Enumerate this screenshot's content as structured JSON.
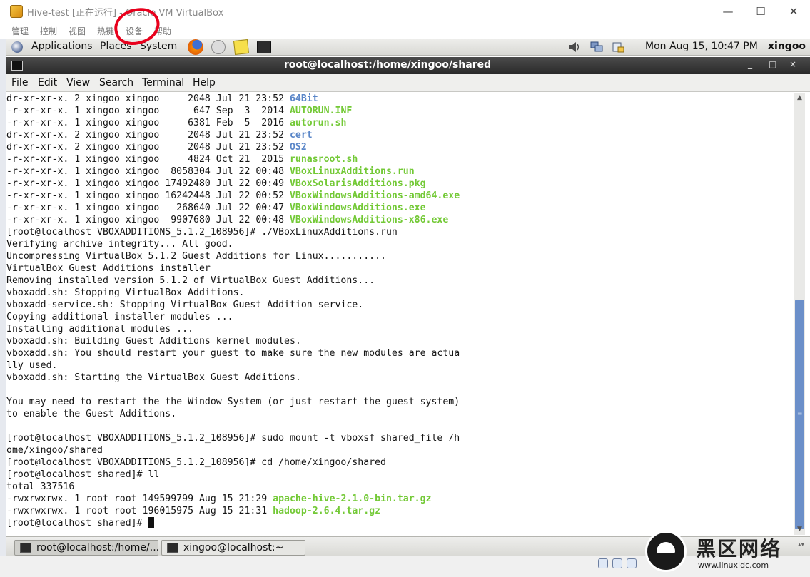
{
  "window": {
    "title": "Hive-test [正在运行] - Oracle VM VirtualBox",
    "minimize_glyph": "—",
    "maximize_glyph": "☐",
    "close_glyph": "✕"
  },
  "vb_menu": [
    "管理",
    "控制",
    "视图",
    "热键",
    "设备",
    "帮助"
  ],
  "gnome_panel": {
    "menus": [
      "Applications",
      "Places",
      "System"
    ],
    "launchers": [
      "firefox-icon",
      "mail-icon",
      "notes-icon",
      "terminal-icon"
    ],
    "tray": [
      "volume-icon",
      "network-icon",
      "updates-icon"
    ],
    "clock": "Mon Aug 15, 10:47 PM",
    "user": "xingoo"
  },
  "terminal": {
    "title": "root@localhost:/home/xingoo/shared",
    "controls": [
      "_",
      "□",
      "×"
    ],
    "menu": [
      "File",
      "Edit",
      "View",
      "Search",
      "Terminal",
      "Help"
    ],
    "lines": [
      [
        {
          "t": "dr-xr-xr-x. 2 xingoo xingoo     2048 Jul 21 23:52 "
        },
        {
          "t": "64Bit",
          "c": "dir"
        }
      ],
      [
        {
          "t": "-r-xr-xr-x. 1 xingoo xingoo      647 Sep  3  2014 "
        },
        {
          "t": "AUTORUN.INF",
          "c": "exe"
        }
      ],
      [
        {
          "t": "-r-xr-xr-x. 1 xingoo xingoo     6381 Feb  5  2016 "
        },
        {
          "t": "autorun.sh",
          "c": "exe"
        }
      ],
      [
        {
          "t": "dr-xr-xr-x. 2 xingoo xingoo     2048 Jul 21 23:52 "
        },
        {
          "t": "cert",
          "c": "dir"
        }
      ],
      [
        {
          "t": "dr-xr-xr-x. 2 xingoo xingoo     2048 Jul 21 23:52 "
        },
        {
          "t": "OS2",
          "c": "dir"
        }
      ],
      [
        {
          "t": "-r-xr-xr-x. 1 xingoo xingoo     4824 Oct 21  2015 "
        },
        {
          "t": "runasroot.sh",
          "c": "exe"
        }
      ],
      [
        {
          "t": "-r-xr-xr-x. 1 xingoo xingoo  8058304 Jul 22 00:48 "
        },
        {
          "t": "VBoxLinuxAdditions.run",
          "c": "exe"
        }
      ],
      [
        {
          "t": "-r-xr-xr-x. 1 xingoo xingoo 17492480 Jul 22 00:49 "
        },
        {
          "t": "VBoxSolarisAdditions.pkg",
          "c": "exe"
        }
      ],
      [
        {
          "t": "-r-xr-xr-x. 1 xingoo xingoo 16242448 Jul 22 00:52 "
        },
        {
          "t": "VBoxWindowsAdditions-amd64.exe",
          "c": "exe"
        }
      ],
      [
        {
          "t": "-r-xr-xr-x. 1 xingoo xingoo   268640 Jul 22 00:47 "
        },
        {
          "t": "VBoxWindowsAdditions.exe",
          "c": "exe"
        }
      ],
      [
        {
          "t": "-r-xr-xr-x. 1 xingoo xingoo  9907680 Jul 22 00:48 "
        },
        {
          "t": "VBoxWindowsAdditions-x86.exe",
          "c": "exe"
        }
      ],
      [
        {
          "t": "[root@localhost VBOXADDITIONS_5.1.2_108956]# ./VBoxLinuxAdditions.run"
        }
      ],
      [
        {
          "t": "Verifying archive integrity... All good."
        }
      ],
      [
        {
          "t": "Uncompressing VirtualBox 5.1.2 Guest Additions for Linux..........."
        }
      ],
      [
        {
          "t": "VirtualBox Guest Additions installer"
        }
      ],
      [
        {
          "t": "Removing installed version 5.1.2 of VirtualBox Guest Additions..."
        }
      ],
      [
        {
          "t": "vboxadd.sh: Stopping VirtualBox Additions."
        }
      ],
      [
        {
          "t": "vboxadd-service.sh: Stopping VirtualBox Guest Addition service."
        }
      ],
      [
        {
          "t": "Copying additional installer modules ..."
        }
      ],
      [
        {
          "t": "Installing additional modules ..."
        }
      ],
      [
        {
          "t": "vboxadd.sh: Building Guest Additions kernel modules."
        }
      ],
      [
        {
          "t": "vboxadd.sh: You should restart your guest to make sure the new modules are actua"
        }
      ],
      [
        {
          "t": "lly used."
        }
      ],
      [
        {
          "t": "vboxadd.sh: Starting the VirtualBox Guest Additions."
        }
      ],
      [
        {
          "t": ""
        }
      ],
      [
        {
          "t": "You may need to restart the the Window System (or just restart the guest system)"
        }
      ],
      [
        {
          "t": "to enable the Guest Additions."
        }
      ],
      [
        {
          "t": ""
        }
      ],
      [
        {
          "t": "[root@localhost VBOXADDITIONS_5.1.2_108956]# sudo mount -t vboxsf shared_file /h"
        }
      ],
      [
        {
          "t": "ome/xingoo/shared"
        }
      ],
      [
        {
          "t": "[root@localhost VBOXADDITIONS_5.1.2_108956]# cd /home/xingoo/shared"
        }
      ],
      [
        {
          "t": "[root@localhost shared]# ll"
        }
      ],
      [
        {
          "t": "total 337516"
        }
      ],
      [
        {
          "t": "-rwxrwxrwx. 1 root root 149599799 Aug 15 21:29 "
        },
        {
          "t": "apache-hive-2.1.0-bin.tar.gz",
          "c": "arch"
        }
      ],
      [
        {
          "t": "-rwxrwxrwx. 1 root root 196015975 Aug 15 21:31 "
        },
        {
          "t": "hadoop-2.6.4.tar.gz",
          "c": "arch"
        }
      ],
      [
        {
          "t": "[root@localhost shared]# "
        },
        {
          "t": "",
          "c": "cursor"
        }
      ]
    ]
  },
  "taskbar": {
    "items": [
      "root@localhost:/home/...",
      "xingoo@localhost:~"
    ]
  },
  "watermark": {
    "logo_text": "黑区网络",
    "url": "www.linuxidc.com"
  },
  "colors": {
    "annotation_circle": "#e8001c",
    "dir_text": "#5a86c8",
    "exec_text": "#73c936",
    "scroll_thumb": "#6b8fc9"
  }
}
